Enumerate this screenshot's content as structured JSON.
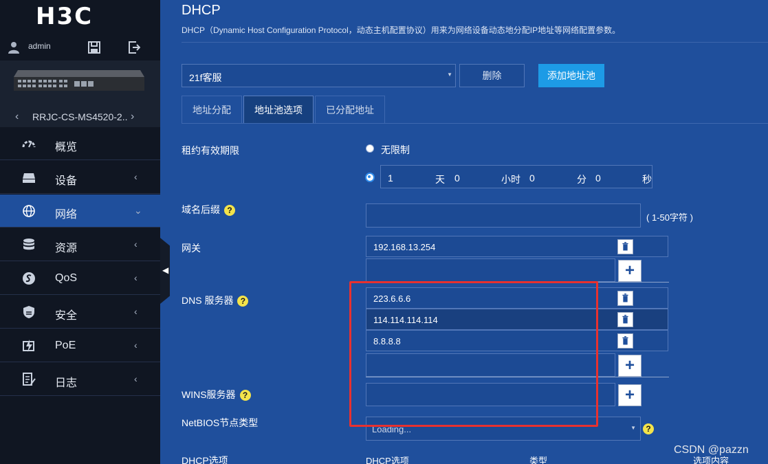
{
  "brand": {
    "logo": "H3C"
  },
  "user": {
    "name": "admin"
  },
  "device": {
    "name": "RRJC-CS-MS4520-2..",
    "prev": "‹",
    "next": "›"
  },
  "nav": [
    {
      "label": "概览",
      "chevron": ""
    },
    {
      "label": "设备",
      "chevron": "‹"
    },
    {
      "label": "网络",
      "chevron": "⌄"
    },
    {
      "label": "资源",
      "chevron": "‹"
    },
    {
      "label": "QoS",
      "chevron": "‹"
    },
    {
      "label": "安全",
      "chevron": "‹"
    },
    {
      "label": "PoE",
      "chevron": "‹"
    },
    {
      "label": "日志",
      "chevron": "‹"
    }
  ],
  "page": {
    "title": "DHCP",
    "description": "DHCP（Dynamic Host Configuration Protocol，动态主机配置协议）用来为网络设备动态地分配IP地址等网络配置参数。"
  },
  "pool": {
    "selected": "21f客服",
    "delete_label": "删除",
    "add_label": "添加地址池"
  },
  "tabs": [
    {
      "label": "地址分配"
    },
    {
      "label": "地址池选项"
    },
    {
      "label": "已分配地址"
    }
  ],
  "lease": {
    "label": "租约有效期限",
    "unlimited_label": "无限制",
    "days": "1",
    "days_unit": "天",
    "hours": "0",
    "hours_unit": "小时",
    "minutes": "0",
    "minutes_unit": "分",
    "seconds": "0",
    "seconds_unit": "秒"
  },
  "domain_suffix": {
    "label": "域名后缀",
    "value": "",
    "hint": "( 1-50字符 )"
  },
  "gateway": {
    "label": "网关",
    "values": [
      "192.168.13.254"
    ]
  },
  "dns": {
    "label": "DNS 服务器",
    "values": [
      "223.6.6.6",
      "114.114.114.114",
      "8.8.8.8"
    ]
  },
  "wins": {
    "label": "WINS服务器"
  },
  "netbios": {
    "label": "NetBIOS节点类型",
    "value": "Loading..."
  },
  "dhcp_options": {
    "label": "DHCP选项",
    "columns": [
      "DHCP选项",
      "类型",
      "选项内容"
    ]
  },
  "help_mark": "?",
  "add_mark": "+",
  "watermark": "CSDN @pazzn"
}
